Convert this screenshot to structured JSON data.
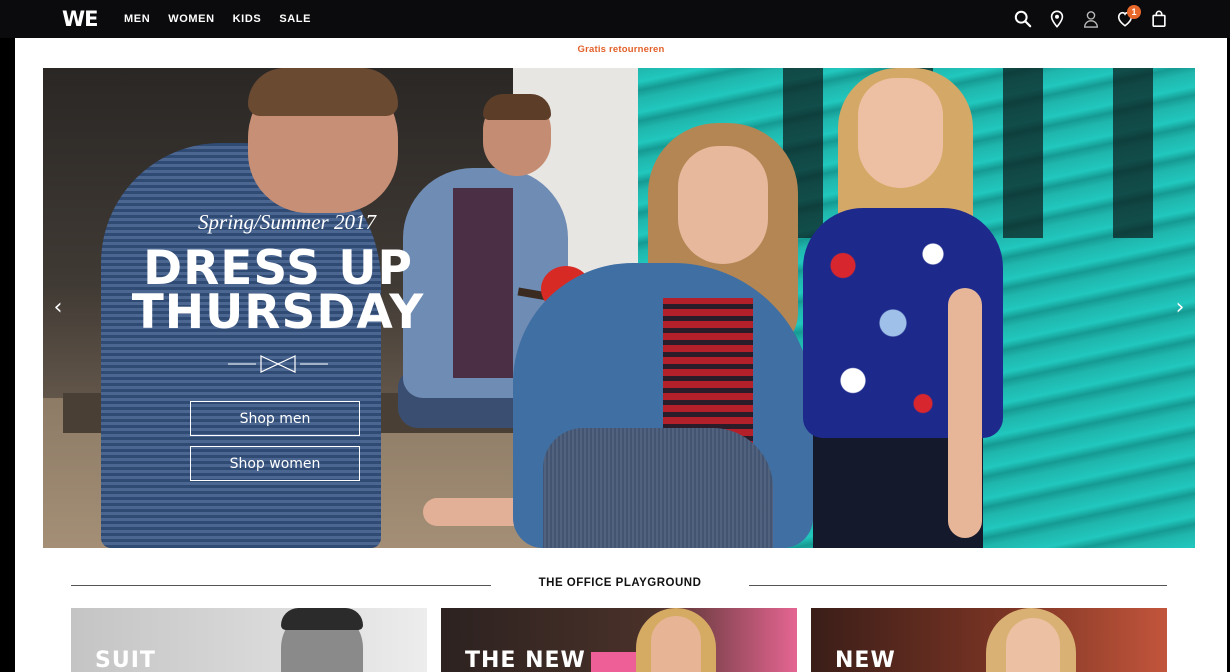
{
  "brand": {
    "logo": "WE"
  },
  "nav": {
    "items": [
      {
        "label": "MEN"
      },
      {
        "label": "WOMEN"
      },
      {
        "label": "KIDS"
      },
      {
        "label": "SALE"
      }
    ]
  },
  "header_icons": {
    "search": "search-icon",
    "store_locator": "location-pin-icon",
    "account": "user-icon",
    "wishlist": "heart-icon",
    "wishlist_count": "1",
    "cart": "shopping-bag-icon"
  },
  "promo": {
    "text": "Gratis retourneren"
  },
  "hero": {
    "subtitle": "Spring/Summer 2017",
    "headline_line1": "DRESS UP",
    "headline_line2": "THURSDAY",
    "cta_men": "Shop men",
    "cta_women": "Shop women",
    "prev_arrow": "‹",
    "next_arrow": "›"
  },
  "section": {
    "title": "THE OFFICE PLAYGROUND"
  },
  "tiles": [
    {
      "label": "SUIT"
    },
    {
      "label": "THE NEW"
    },
    {
      "label": "NEW"
    }
  ],
  "colors": {
    "accent": "#e8682b",
    "topbar": "#0b0b0d",
    "promo": "#e2612a"
  }
}
